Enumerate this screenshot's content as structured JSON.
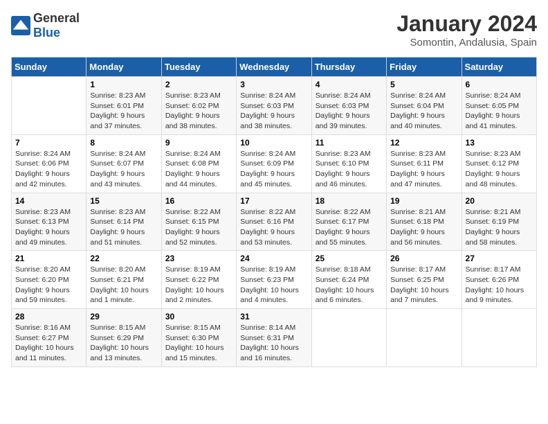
{
  "logo": {
    "text_general": "General",
    "text_blue": "Blue"
  },
  "title": "January 2024",
  "subtitle": "Somontin, Andalusia, Spain",
  "header": {
    "days": [
      "Sunday",
      "Monday",
      "Tuesday",
      "Wednesday",
      "Thursday",
      "Friday",
      "Saturday"
    ]
  },
  "weeks": [
    [
      {
        "day": "",
        "info": ""
      },
      {
        "day": "1",
        "info": "Sunrise: 8:23 AM\nSunset: 6:01 PM\nDaylight: 9 hours\nand 37 minutes."
      },
      {
        "day": "2",
        "info": "Sunrise: 8:23 AM\nSunset: 6:02 PM\nDaylight: 9 hours\nand 38 minutes."
      },
      {
        "day": "3",
        "info": "Sunrise: 8:24 AM\nSunset: 6:03 PM\nDaylight: 9 hours\nand 38 minutes."
      },
      {
        "day": "4",
        "info": "Sunrise: 8:24 AM\nSunset: 6:03 PM\nDaylight: 9 hours\nand 39 minutes."
      },
      {
        "day": "5",
        "info": "Sunrise: 8:24 AM\nSunset: 6:04 PM\nDaylight: 9 hours\nand 40 minutes."
      },
      {
        "day": "6",
        "info": "Sunrise: 8:24 AM\nSunset: 6:05 PM\nDaylight: 9 hours\nand 41 minutes."
      }
    ],
    [
      {
        "day": "7",
        "info": "Sunrise: 8:24 AM\nSunset: 6:06 PM\nDaylight: 9 hours\nand 42 minutes."
      },
      {
        "day": "8",
        "info": "Sunrise: 8:24 AM\nSunset: 6:07 PM\nDaylight: 9 hours\nand 43 minutes."
      },
      {
        "day": "9",
        "info": "Sunrise: 8:24 AM\nSunset: 6:08 PM\nDaylight: 9 hours\nand 44 minutes."
      },
      {
        "day": "10",
        "info": "Sunrise: 8:24 AM\nSunset: 6:09 PM\nDaylight: 9 hours\nand 45 minutes."
      },
      {
        "day": "11",
        "info": "Sunrise: 8:23 AM\nSunset: 6:10 PM\nDaylight: 9 hours\nand 46 minutes."
      },
      {
        "day": "12",
        "info": "Sunrise: 8:23 AM\nSunset: 6:11 PM\nDaylight: 9 hours\nand 47 minutes."
      },
      {
        "day": "13",
        "info": "Sunrise: 8:23 AM\nSunset: 6:12 PM\nDaylight: 9 hours\nand 48 minutes."
      }
    ],
    [
      {
        "day": "14",
        "info": "Sunrise: 8:23 AM\nSunset: 6:13 PM\nDaylight: 9 hours\nand 49 minutes."
      },
      {
        "day": "15",
        "info": "Sunrise: 8:23 AM\nSunset: 6:14 PM\nDaylight: 9 hours\nand 51 minutes."
      },
      {
        "day": "16",
        "info": "Sunrise: 8:22 AM\nSunset: 6:15 PM\nDaylight: 9 hours\nand 52 minutes."
      },
      {
        "day": "17",
        "info": "Sunrise: 8:22 AM\nSunset: 6:16 PM\nDaylight: 9 hours\nand 53 minutes."
      },
      {
        "day": "18",
        "info": "Sunrise: 8:22 AM\nSunset: 6:17 PM\nDaylight: 9 hours\nand 55 minutes."
      },
      {
        "day": "19",
        "info": "Sunrise: 8:21 AM\nSunset: 6:18 PM\nDaylight: 9 hours\nand 56 minutes."
      },
      {
        "day": "20",
        "info": "Sunrise: 8:21 AM\nSunset: 6:19 PM\nDaylight: 9 hours\nand 58 minutes."
      }
    ],
    [
      {
        "day": "21",
        "info": "Sunrise: 8:20 AM\nSunset: 6:20 PM\nDaylight: 9 hours\nand 59 minutes."
      },
      {
        "day": "22",
        "info": "Sunrise: 8:20 AM\nSunset: 6:21 PM\nDaylight: 10 hours\nand 1 minute."
      },
      {
        "day": "23",
        "info": "Sunrise: 8:19 AM\nSunset: 6:22 PM\nDaylight: 10 hours\nand 2 minutes."
      },
      {
        "day": "24",
        "info": "Sunrise: 8:19 AM\nSunset: 6:23 PM\nDaylight: 10 hours\nand 4 minutes."
      },
      {
        "day": "25",
        "info": "Sunrise: 8:18 AM\nSunset: 6:24 PM\nDaylight: 10 hours\nand 6 minutes."
      },
      {
        "day": "26",
        "info": "Sunrise: 8:17 AM\nSunset: 6:25 PM\nDaylight: 10 hours\nand 7 minutes."
      },
      {
        "day": "27",
        "info": "Sunrise: 8:17 AM\nSunset: 6:26 PM\nDaylight: 10 hours\nand 9 minutes."
      }
    ],
    [
      {
        "day": "28",
        "info": "Sunrise: 8:16 AM\nSunset: 6:27 PM\nDaylight: 10 hours\nand 11 minutes."
      },
      {
        "day": "29",
        "info": "Sunrise: 8:15 AM\nSunset: 6:29 PM\nDaylight: 10 hours\nand 13 minutes."
      },
      {
        "day": "30",
        "info": "Sunrise: 8:15 AM\nSunset: 6:30 PM\nDaylight: 10 hours\nand 15 minutes."
      },
      {
        "day": "31",
        "info": "Sunrise: 8:14 AM\nSunset: 6:31 PM\nDaylight: 10 hours\nand 16 minutes."
      },
      {
        "day": "",
        "info": ""
      },
      {
        "day": "",
        "info": ""
      },
      {
        "day": "",
        "info": ""
      }
    ]
  ]
}
